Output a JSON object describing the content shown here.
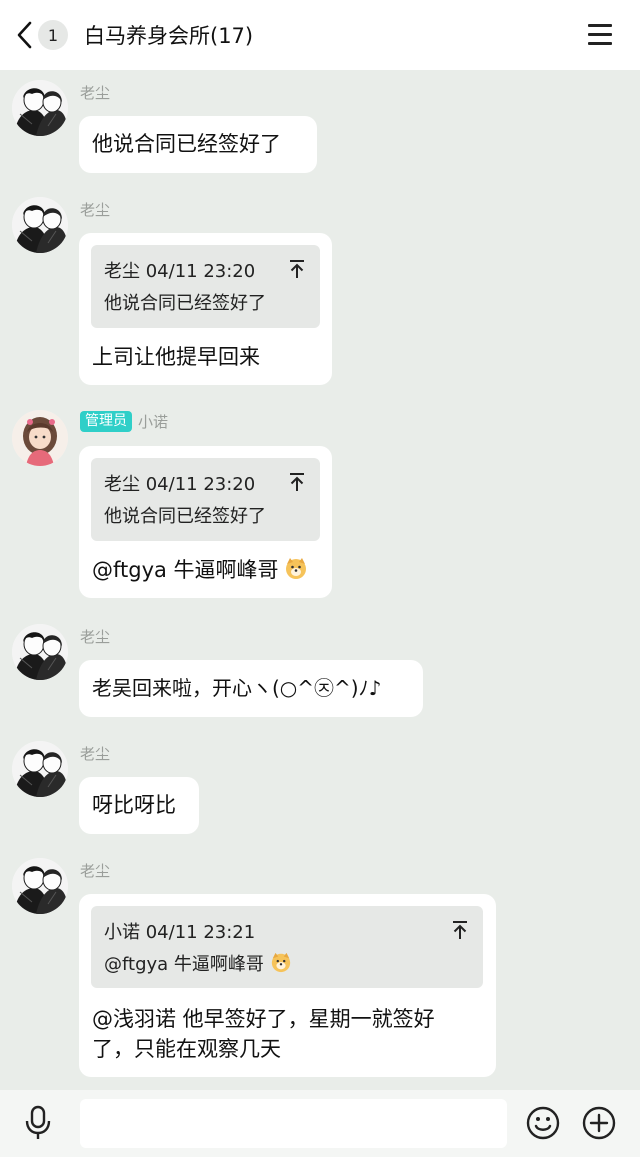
{
  "header": {
    "back_badge": "1",
    "title": "白马养身会所(17)"
  },
  "messages": [
    {
      "sender": "老尘",
      "text": "他说合同已经签好了"
    },
    {
      "sender": "老尘",
      "quote_head": "老尘 04/11 23:20",
      "quote_text": "他说合同已经签好了",
      "text": "上司让他提早回来"
    },
    {
      "badge": "管理员",
      "sender": "小诺",
      "quote_head": "老尘 04/11 23:20",
      "quote_text": "他说合同已经签好了",
      "text": "@ftgya 牛逼啊峰哥"
    },
    {
      "sender": "老尘",
      "text": "老吴回来啦，开心ヽ(○^㉨^)ﾉ♪"
    },
    {
      "sender": "老尘",
      "text": "呀比呀比"
    },
    {
      "sender": "老尘",
      "quote_head": "小诺 04/11 23:21",
      "quote_text": "@ftgya 牛逼啊峰哥",
      "text_line1": "@浅羽诺 他早签好了，星期一就签好",
      "text_line2": "了，只能在观察几天"
    }
  ],
  "footer": {
    "input_placeholder": ""
  },
  "colors": {
    "admin_badge": "#2fcfc8",
    "chat_bg": "#e9ede9"
  }
}
